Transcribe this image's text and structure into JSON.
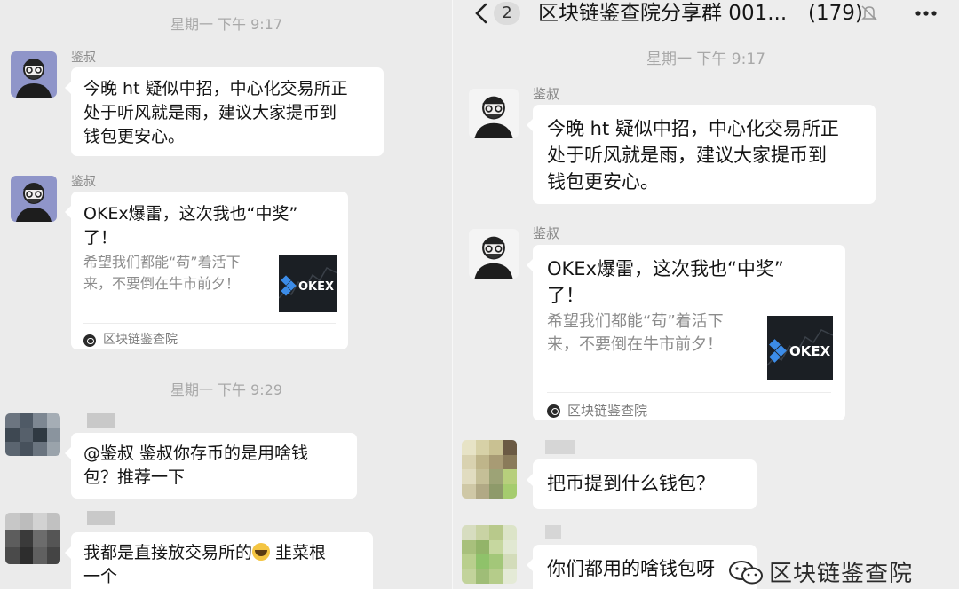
{
  "left": {
    "timestamp_1": "星期一 下午 9:17",
    "timestamp_2": "星期一 下午 9:29",
    "messages": [
      {
        "sender": "鉴叔",
        "text": "今晚 ht 疑似中招，中心化交易所正\n处于听风就是雨，建议大家提币到\n钱包更安心。"
      },
      {
        "sender": "鉴叔",
        "card": {
          "title": "OKEx爆雷，这次我也“中奖”\n了！",
          "desc": "希望我们都能“苟”着活下\n来，不要倒在牛市前夕！",
          "thumb_text": "OKEX",
          "source": "区块链鉴查院"
        }
      },
      {
        "text": "@鉴叔  鉴叔你存币的是用啥钱\n包？推荐一下"
      },
      {
        "text_before_emoji": "我都是直接放交易所的",
        "text_after_emoji": " 韭菜根\n一个"
      }
    ]
  },
  "right": {
    "header": {
      "badge": "2",
      "title": "区块链鉴查院分享群 001...",
      "count": "(179)",
      "icons": [
        "back-icon",
        "mute-icon",
        "more-icon"
      ]
    },
    "timestamp_1": "星期一 下午 9:17",
    "messages": [
      {
        "sender": "鉴叔",
        "text": "今晚 ht 疑似中招，中心化交易所正\n处于听风就是雨，建议大家提币到\n钱包更安心。"
      },
      {
        "sender": "鉴叔",
        "card": {
          "title": "OKEx爆雷，这次我也“中奖”\n了！",
          "desc": "希望我们都能“苟”着活下\n来，不要倒在牛市前夕！",
          "thumb_text": "OKEX",
          "source": "区块链鉴查院"
        }
      },
      {
        "text": "把币提到什么钱包？"
      },
      {
        "text": "你们都用的啥钱包呀"
      }
    ]
  },
  "watermark": "区块链鉴查院",
  "colors": {
    "background": "#ededed",
    "bubble": "#ffffff",
    "timestamp": "#a8a8a8",
    "brand_blue": "#3c8ce8"
  }
}
